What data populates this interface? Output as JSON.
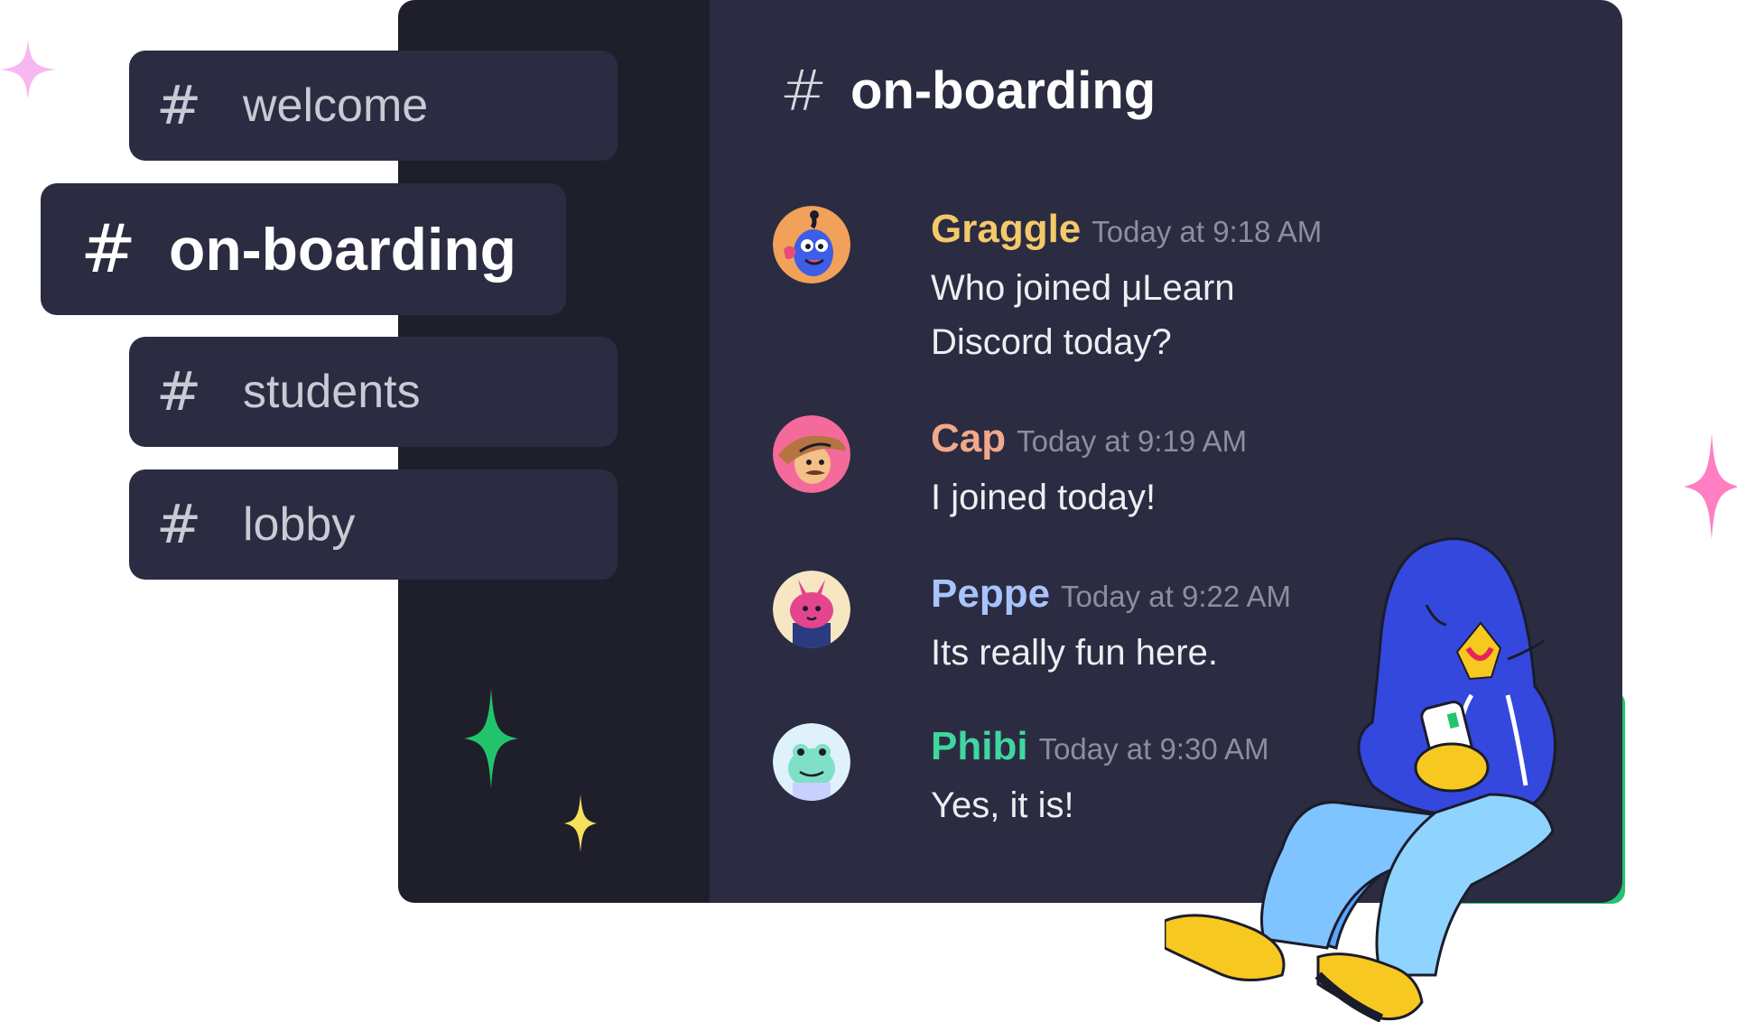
{
  "sidebar": {
    "channels": [
      {
        "label": "welcome",
        "hash": "#"
      },
      {
        "label": "on-boarding",
        "hash": "#",
        "active": true
      },
      {
        "label": "students",
        "hash": "#"
      },
      {
        "label": "lobby",
        "hash": "#"
      }
    ]
  },
  "chat": {
    "hash": "#",
    "title": "on-boarding",
    "messages": [
      {
        "username": "Graggle",
        "timestamp": "Today at 9:18 AM",
        "text": "Who joined μLearn Discord today?",
        "color": "#f5c96a"
      },
      {
        "username": "Cap",
        "timestamp": "Today at 9:19 AM",
        "text": "I joined today!",
        "color": "#f3a88a"
      },
      {
        "username": "Peppe",
        "timestamp": "Today at 9:22 AM",
        "text": "Its really fun here.",
        "color": "#a9c3ff"
      },
      {
        "username": "Phibi",
        "timestamp": "Today at 9:30 AM",
        "text": "Yes, it is!",
        "color": "#3fd79f"
      }
    ]
  },
  "colors": {
    "panel": "#2b2c41",
    "sidebar": "#1e1f2b",
    "sparkle_green": "#22c46b",
    "sparkle_yellow": "#f7e15a",
    "sparkle_pink": "#ff7fc2",
    "sparkle_light_pink": "#f6b8ee"
  },
  "icons": [
    "sparkle-icon",
    "hash-icon",
    "avatar-illustration",
    "character-illustration"
  ]
}
